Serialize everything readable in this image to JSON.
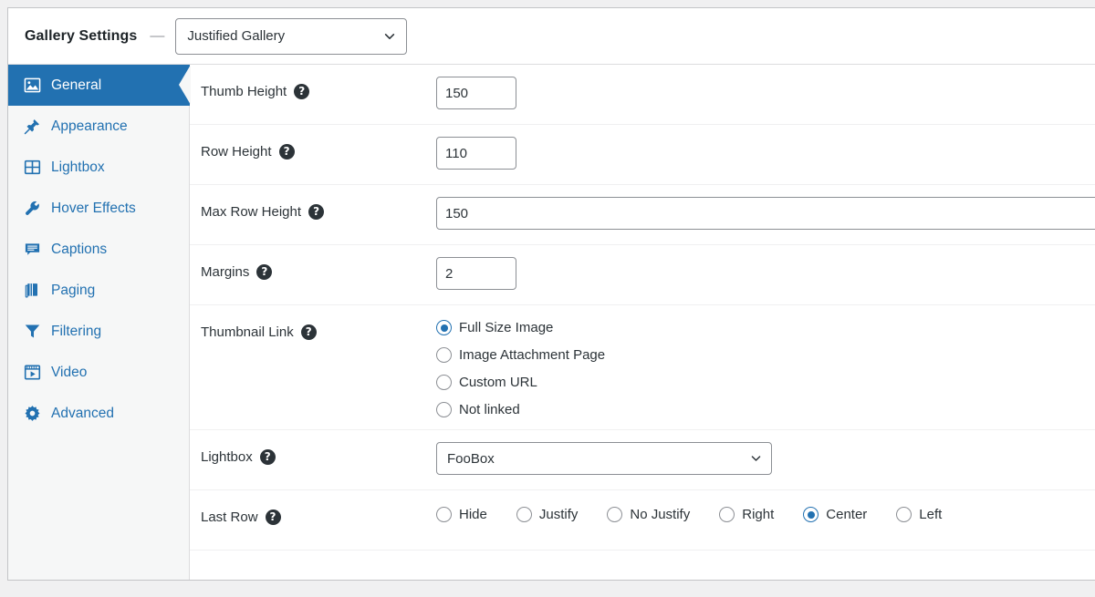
{
  "header": {
    "title": "Gallery Settings",
    "separator": "—",
    "template_select": {
      "value": "Justified Gallery",
      "icon": "chevron-down-icon"
    }
  },
  "sidebar": {
    "items": [
      {
        "label": "General",
        "icon": "image-icon",
        "active": true
      },
      {
        "label": "Appearance",
        "icon": "pin-icon",
        "active": false
      },
      {
        "label": "Lightbox",
        "icon": "grid-icon",
        "active": false
      },
      {
        "label": "Hover Effects",
        "icon": "wrench-icon",
        "active": false
      },
      {
        "label": "Captions",
        "icon": "comment-icon",
        "active": false
      },
      {
        "label": "Paging",
        "icon": "book-icon",
        "active": false
      },
      {
        "label": "Filtering",
        "icon": "funnel-icon",
        "active": false
      },
      {
        "label": "Video",
        "icon": "video-icon",
        "active": false
      },
      {
        "label": "Advanced",
        "icon": "gear-icon",
        "active": false
      }
    ]
  },
  "fields": {
    "thumb_height": {
      "label": "Thumb Height",
      "help": "?",
      "value": "150"
    },
    "row_height": {
      "label": "Row Height",
      "help": "?",
      "value": "110"
    },
    "max_row_height": {
      "label": "Max Row Height",
      "help": "?",
      "value": "150"
    },
    "margins": {
      "label": "Margins",
      "help": "?",
      "value": "2"
    },
    "thumbnail_link": {
      "label": "Thumbnail Link",
      "help": "?",
      "options": [
        {
          "label": "Full Size Image",
          "checked": true
        },
        {
          "label": "Image Attachment Page",
          "checked": false
        },
        {
          "label": "Custom URL",
          "checked": false
        },
        {
          "label": "Not linked",
          "checked": false
        }
      ]
    },
    "lightbox": {
      "label": "Lightbox",
      "help": "?",
      "value": "FooBox",
      "icon": "chevron-down-icon"
    },
    "last_row": {
      "label": "Last Row",
      "help": "?",
      "options": [
        {
          "label": "Hide",
          "checked": false
        },
        {
          "label": "Justify",
          "checked": false
        },
        {
          "label": "No Justify",
          "checked": false
        },
        {
          "label": "Right",
          "checked": false
        },
        {
          "label": "Center",
          "checked": true
        },
        {
          "label": "Left",
          "checked": false
        }
      ]
    }
  },
  "colors": {
    "accent": "#2271b1",
    "sidebar_bg": "#f6f7f7",
    "border": "#c3c4c7",
    "text": "#2c3338"
  }
}
